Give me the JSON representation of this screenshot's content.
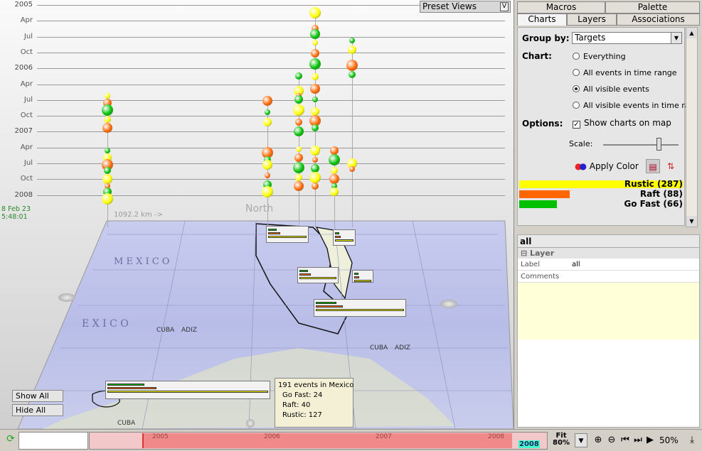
{
  "timeline": {
    "y_labels": [
      {
        "text": "2005",
        "year": true
      },
      {
        "text": "Apr"
      },
      {
        "text": "Jul"
      },
      {
        "text": "Oct"
      },
      {
        "text": "2006",
        "year": true
      },
      {
        "text": "Apr"
      },
      {
        "text": "Jul"
      },
      {
        "text": "Oct"
      },
      {
        "text": "2007",
        "year": true
      },
      {
        "text": "Apr"
      },
      {
        "text": "Jul"
      },
      {
        "text": "Oct"
      },
      {
        "text": "2008",
        "year": true
      }
    ],
    "date_line1": "8 Feb 23",
    "date_line2": "5:48:01",
    "distance": "1092.2 km ->",
    "north": "North",
    "preset_views": "Preset Views",
    "preset_arrow": "V"
  },
  "map": {
    "labels": [
      "M E X I C O",
      "E X I C O",
      "CUBA",
      "ADIZ",
      "CUBA",
      "ADIZ",
      "CUBA"
    ],
    "colors": {
      "rustic": "#ffff00",
      "raft": "#ff6600",
      "gofast": "#00c000"
    },
    "show_all": "Show All",
    "hide_all": "Hide All",
    "tooltip": {
      "title": "191 events in Mexico",
      "lines": [
        "Go Fast: 24",
        "Raft: 40",
        "Rustic: 127"
      ]
    }
  },
  "panel": {
    "tabs_top": [
      "Macros",
      "Palette"
    ],
    "tabs_bottom": [
      "Charts",
      "Layers",
      "Associations"
    ],
    "group_by_label": "Group by:",
    "group_by_value": "Targets",
    "chart_label": "Chart:",
    "chart_options": [
      "Everything",
      "All events in time range",
      "All visible events",
      "All visible events in time ra..."
    ],
    "chart_selected": 2,
    "options_label": "Options:",
    "show_charts": "Show charts on map",
    "scale_label": "Scale:",
    "apply_color": "Apply Color",
    "legend": [
      {
        "label": "Rustic (287)",
        "value": 287,
        "color": "#ffff00"
      },
      {
        "label": "Raft (88)",
        "value": 88,
        "color": "#ff6600"
      },
      {
        "label": "Go Fast (66)",
        "value": 66,
        "color": "#00c000"
      }
    ]
  },
  "props": {
    "title": "all",
    "section": "Layer",
    "rows": [
      {
        "key": "Label",
        "value": "all"
      },
      {
        "key": "Comments",
        "value": ""
      }
    ]
  },
  "bottom": {
    "ticks": [
      "2005",
      "2006",
      "2007",
      "2008"
    ],
    "end_label": "2008",
    "fit_line1": "Fit",
    "fit_line2": "80%",
    "zoom": "50%"
  }
}
